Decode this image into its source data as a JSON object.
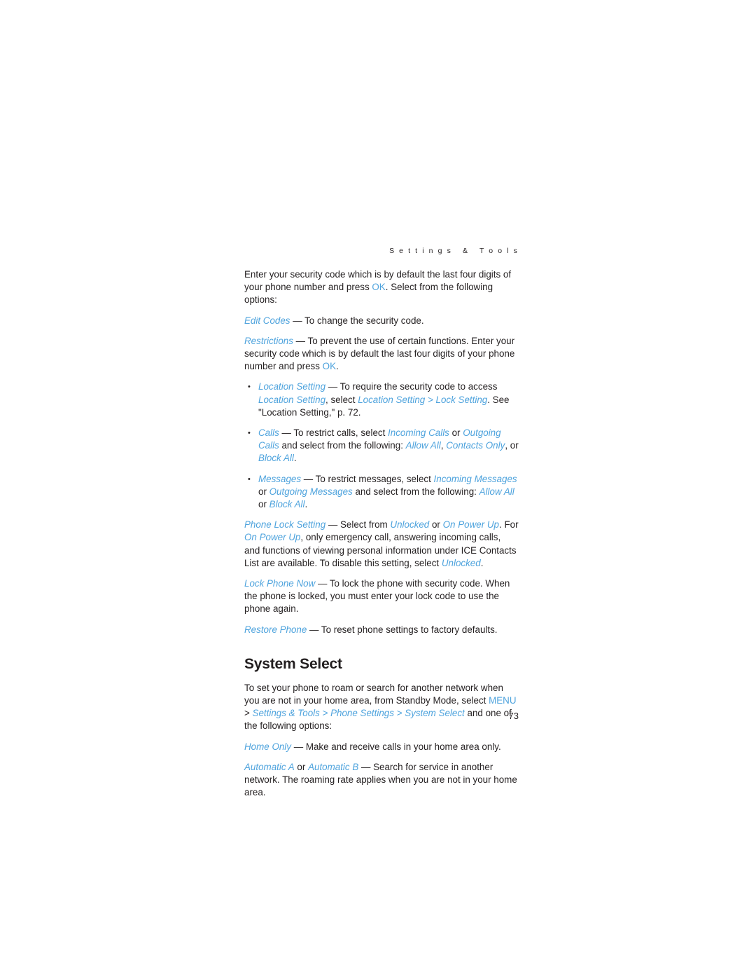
{
  "header": "S e t t i n g s   &   T o o l s",
  "page_number": "73",
  "paragraphs": {
    "intro": {
      "p1a": "Enter your security code which is by default the last four digits of ",
      "p1b": "your phone number and press ",
      "ok1": "OK",
      "p1c": ". Select from the following options:"
    },
    "edit_codes": {
      "term": "Edit Codes",
      "rest": " — To change the security code."
    },
    "restrictions": {
      "term": "Restrictions",
      "rest1": " — To prevent the use of certain functions. Enter your security code which is by default the last four digits of your phone number and press ",
      "ok": "OK",
      "rest2": "."
    },
    "bullets": [
      {
        "t1": "Location Setting",
        "s1": " — To require the security code to access ",
        "t2": "Location Setting",
        "s2": ", select ",
        "t3": "Location Setting",
        "s3": " > ",
        "t4": "Lock Setting",
        "s4": ". See \"Location Setting,\" p. 72."
      },
      {
        "t1": "Calls",
        "s1": " — To restrict calls, select ",
        "t2": "Incoming Calls",
        "s2": " or ",
        "t3": "Outgoing Calls",
        "s3": " and select from the following: ",
        "t4": "Allow All",
        "s4": ", ",
        "t5": "Contacts Only",
        "s5": ", or ",
        "t6": "Block All",
        "s6": "."
      },
      {
        "t1": "Messages",
        "s1": " — To restrict messages, select ",
        "t2": "Incoming Messages",
        "s2": " or ",
        "t3": "Outgoing Messages",
        "s3": " and select from the following: ",
        "t4": "Allow All",
        "s4": " or ",
        "t5": "Block All",
        "s5": "."
      }
    ],
    "phone_lock": {
      "t1": "Phone Lock Setting",
      "s1": " — Select from ",
      "t2": "Unlocked",
      "s2": " or ",
      "t3": "On Power Up",
      "s3": ". For ",
      "t4": "On Power Up",
      "s4": ", only emergency call, answering incoming calls, and functions of viewing personal information under ICE Contacts List are available. To disable this setting, select ",
      "t5": "Unlocked",
      "s5": "."
    },
    "lock_phone_now": {
      "term": "Lock Phone Now",
      "rest": " — To lock the phone with security code. When the phone is locked, you must enter your lock code to use the phone again."
    },
    "restore_phone": {
      "term": "Restore Phone",
      "rest": " — To reset phone settings to factory defaults."
    }
  },
  "system_select": {
    "heading": "System Select",
    "intro": {
      "s1": "To set your phone to roam or search for another network when you are not in your home area, from Standby Mode, select ",
      "menu": "MENU",
      "s2": " > ",
      "t1": "Settings & Tools",
      "s3": " > ",
      "t2": "Phone Settings",
      "s4": " > ",
      "t3": "System Select",
      "s5": " and one of the following options:"
    },
    "home_only": {
      "term": "Home Only",
      "rest": " — Make and receive calls in your home area only."
    },
    "automatic": {
      "t1": "Automatic A",
      "s1": " or ",
      "t2": "Automatic B",
      "s2": " — Search for service in another network. The roaming rate applies when you are not in your home area."
    }
  }
}
